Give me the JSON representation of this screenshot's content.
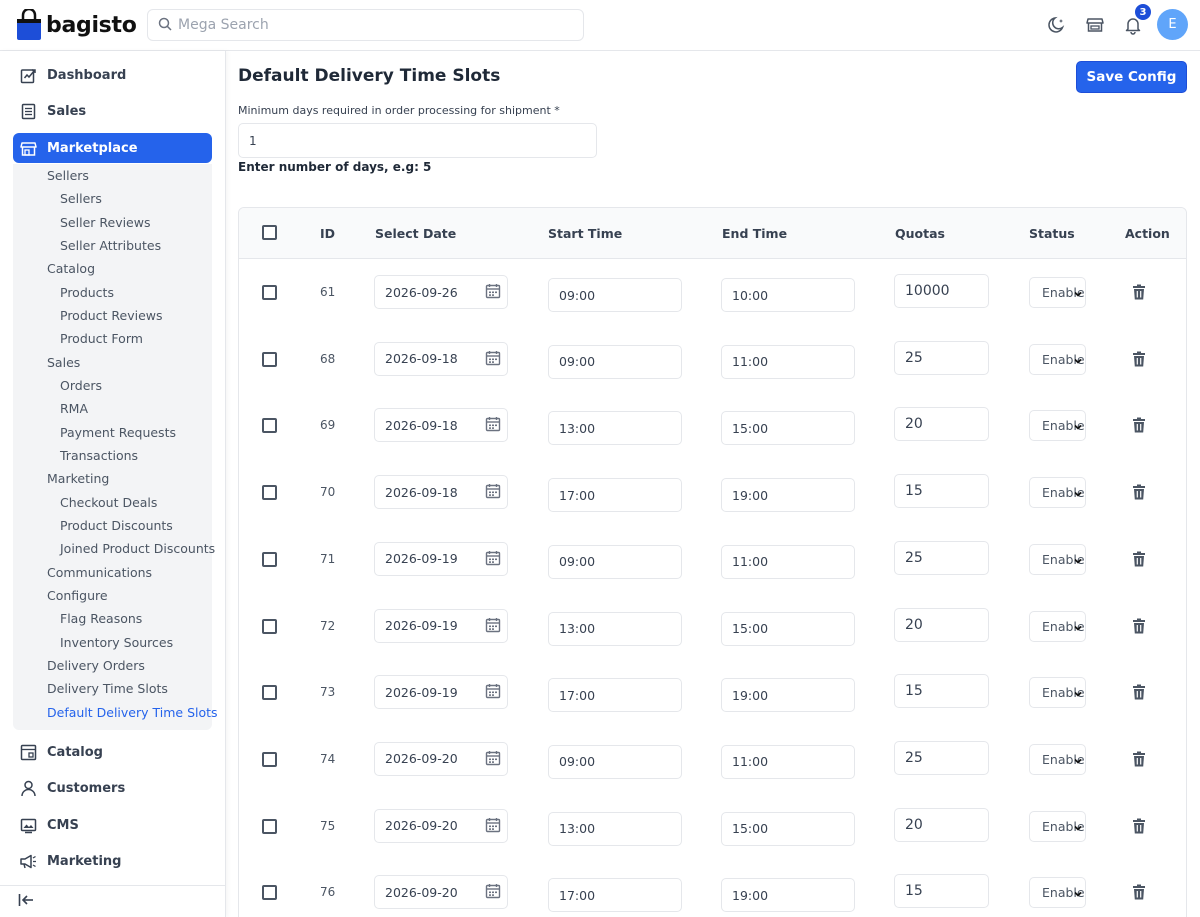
{
  "brand": {
    "name": "bagisto"
  },
  "search": {
    "placeholder": "Mega Search"
  },
  "header": {
    "notification_count": "3",
    "avatar_initial": "E"
  },
  "sidebar": {
    "top_items": [
      {
        "label": "Dashboard",
        "icon": "dashboard-icon"
      },
      {
        "label": "Sales",
        "icon": "receipt-icon"
      },
      {
        "label": "Marketplace",
        "icon": "store-icon",
        "active": true
      }
    ],
    "submenu": [
      {
        "label": "Sellers",
        "level": 1
      },
      {
        "label": "Sellers",
        "level": 2
      },
      {
        "label": "Seller Reviews",
        "level": 2
      },
      {
        "label": "Seller Attributes",
        "level": 2
      },
      {
        "label": "Catalog",
        "level": 1
      },
      {
        "label": "Products",
        "level": 2
      },
      {
        "label": "Product Reviews",
        "level": 2
      },
      {
        "label": "Product Form",
        "level": 2
      },
      {
        "label": "Sales",
        "level": 1
      },
      {
        "label": "Orders",
        "level": 2
      },
      {
        "label": "RMA",
        "level": 2
      },
      {
        "label": "Payment Requests",
        "level": 2
      },
      {
        "label": "Transactions",
        "level": 2
      },
      {
        "label": "Marketing",
        "level": 1
      },
      {
        "label": "Checkout Deals",
        "level": 2
      },
      {
        "label": "Product Discounts",
        "level": 2
      },
      {
        "label": "Joined Product Discounts",
        "level": 2
      },
      {
        "label": "Communications",
        "level": 1
      },
      {
        "label": "Configure",
        "level": 1
      },
      {
        "label": "Flag Reasons",
        "level": 2
      },
      {
        "label": "Inventory Sources",
        "level": 2
      },
      {
        "label": "Delivery Orders",
        "level": 1
      },
      {
        "label": "Delivery Time Slots",
        "level": 1
      },
      {
        "label": "Default Delivery Time Slots",
        "level": 1,
        "active": true
      }
    ],
    "bottom_items": [
      {
        "label": "Catalog",
        "icon": "catalog-icon"
      },
      {
        "label": "Customers",
        "icon": "user-icon"
      },
      {
        "label": "CMS",
        "icon": "cms-icon"
      },
      {
        "label": "Marketing",
        "icon": "megaphone-icon"
      }
    ]
  },
  "page": {
    "title": "Default Delivery Time Slots",
    "save_label": "Save Config",
    "min_days_label": "Minimum days required in order processing for shipment *",
    "min_days_value": "1",
    "hint": "Enter number of days, e.g: 5"
  },
  "table": {
    "headers": {
      "id": "ID",
      "date": "Select Date",
      "start": "Start Time",
      "end": "End Time",
      "quotas": "Quotas",
      "status": "Status",
      "action": "Action"
    },
    "rows": [
      {
        "id": "61",
        "date": "2026-09-26",
        "start": "09:00",
        "end": "10:00",
        "quota": "10000",
        "status": "Enabled"
      },
      {
        "id": "68",
        "date": "2026-09-18",
        "start": "09:00",
        "end": "11:00",
        "quota": "25",
        "status": "Enabled"
      },
      {
        "id": "69",
        "date": "2026-09-18",
        "start": "13:00",
        "end": "15:00",
        "quota": "20",
        "status": "Enabled"
      },
      {
        "id": "70",
        "date": "2026-09-18",
        "start": "17:00",
        "end": "19:00",
        "quota": "15",
        "status": "Enabled"
      },
      {
        "id": "71",
        "date": "2026-09-19",
        "start": "09:00",
        "end": "11:00",
        "quota": "25",
        "status": "Enabled"
      },
      {
        "id": "72",
        "date": "2026-09-19",
        "start": "13:00",
        "end": "15:00",
        "quota": "20",
        "status": "Enabled"
      },
      {
        "id": "73",
        "date": "2026-09-19",
        "start": "17:00",
        "end": "19:00",
        "quota": "15",
        "status": "Enabled"
      },
      {
        "id": "74",
        "date": "2026-09-20",
        "start": "09:00",
        "end": "11:00",
        "quota": "25",
        "status": "Enabled"
      },
      {
        "id": "75",
        "date": "2026-09-20",
        "start": "13:00",
        "end": "15:00",
        "quota": "20",
        "status": "Enabled"
      },
      {
        "id": "76",
        "date": "2026-09-20",
        "start": "17:00",
        "end": "19:00",
        "quota": "15",
        "status": "Enabled"
      }
    ]
  },
  "colors": {
    "accent": "#2563eb",
    "sidebar_sub_bg": "#f3f4f6"
  }
}
